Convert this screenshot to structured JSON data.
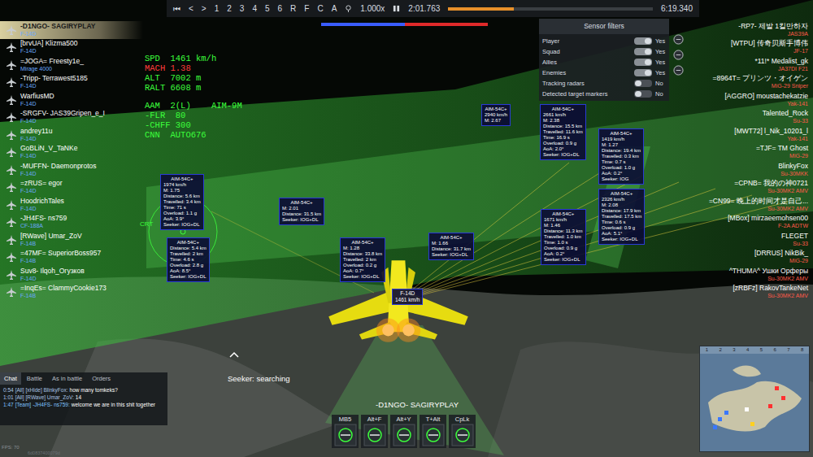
{
  "replay_bar": {
    "controls": [
      "⏮",
      "<",
      ">"
    ],
    "cameras": [
      "1",
      "2",
      "3",
      "4",
      "5",
      "6",
      "R",
      "F",
      "C",
      "A"
    ],
    "speed": "1.000x",
    "time": "2:01.763",
    "duration": "6:19.340",
    "level": 0.32
  },
  "score_bar": {
    "level": 0.5
  },
  "hud": {
    "flight": [
      {
        "text": "SPD  1461 km/h",
        "color": "#3cff3c"
      },
      {
        "text": "MACH 1.38",
        "color": "#ff3b3b"
      },
      {
        "text": "ALT  7002 m",
        "color": "#3cff3c"
      },
      {
        "text": "RALT 6608 m",
        "color": "#3cff3c"
      }
    ],
    "weapons": [
      {
        "text": "AAM  2(L)    AIM-9M",
        "color": "#3cff3c"
      },
      {
        "text": "-FLR  80",
        "color": "#3cff3c"
      },
      {
        "text": "-CHFF 300",
        "color": "#3cff3c"
      },
      {
        "text": "CNN  AUTO676",
        "color": "#3cff3c"
      }
    ],
    "reticle_label": "CRT",
    "seeker_status": "Seeker: searching"
  },
  "sensor_filters": {
    "title": "Sensor filters",
    "rows": [
      {
        "label": "Player",
        "on": true,
        "value": "Yes"
      },
      {
        "label": "Squad",
        "on": true,
        "value": "Yes"
      },
      {
        "label": "Allies",
        "on": true,
        "value": "Yes"
      },
      {
        "label": "Enemies",
        "on": true,
        "value": "Yes"
      },
      {
        "label": "Tracking radars",
        "on": false,
        "value": "No"
      },
      {
        "label": "Detected target markers",
        "on": false,
        "value": "No"
      }
    ]
  },
  "allies": [
    {
      "name": "-D1NGO- SAGIRYPLAY",
      "vehicle": "F-14D",
      "selected": true
    },
    {
      "name": "[brvUA] Klizma500",
      "vehicle": "F-14D",
      "selected": false
    },
    {
      "name": "=JOGA= Freesty1e_",
      "vehicle": "Mirage 4000",
      "selected": false
    },
    {
      "name": "-Tripp- Terrawest5185",
      "vehicle": "F-14D",
      "selected": false
    },
    {
      "name": "WarfiusMD",
      "vehicle": "F-14D",
      "selected": false
    },
    {
      "name": "-SRGFV- JAS39Gripen_e_I",
      "vehicle": "F-14D",
      "selected": false
    },
    {
      "name": "andrey11u",
      "vehicle": "F-14D",
      "selected": false
    },
    {
      "name": "GoBLiN_V_TaNKe",
      "vehicle": "F-14D",
      "selected": false
    },
    {
      "name": "-MUFFN- Daemonprotos",
      "vehicle": "F-14D",
      "selected": false
    },
    {
      "name": "=zRUS= egor",
      "vehicle": "F-14D",
      "selected": false
    },
    {
      "name": "HoodrichTales",
      "vehicle": "F-14D",
      "selected": false
    },
    {
      "name": "-JH4FS- ns759",
      "vehicle": "CF-188A",
      "selected": false
    },
    {
      "name": "[RWave] Umar_ZoV",
      "vehicle": "F-14B",
      "selected": false
    },
    {
      "name": "=47MF= SuperiorBoss957",
      "vehicle": "F-14B",
      "selected": false
    },
    {
      "name": "Suv8- Ilqoh_Огузков",
      "vehicle": "F-14D",
      "selected": false
    },
    {
      "name": "=InqEs= ClammyCookie173",
      "vehicle": "F-14B",
      "selected": false
    }
  ],
  "enemies": [
    {
      "name": "-RP7- 제발 1킬만하자",
      "vehicle": "JAS39A"
    },
    {
      "name": "[WTPU] 传奇贝斯手博伟",
      "vehicle": "JF-17"
    },
    {
      "name": "*11!* Medalist_gk",
      "vehicle": "JA37DI F21"
    },
    {
      "name": "=8964T= プリンツ・オイゲン",
      "vehicle": "MiG-29 Sniper"
    },
    {
      "name": "[AGGRO] moustachekatzie",
      "vehicle": "Yak-141"
    },
    {
      "name": "Talented_Rock",
      "vehicle": "Su-33"
    },
    {
      "name": "[MWT72] l_Nik_10201_l",
      "vehicle": "Yak-141"
    },
    {
      "name": "=TJF= TM Ghost",
      "vehicle": "MiG-29"
    },
    {
      "name": "BlinkyFox",
      "vehicle": "Su-30MKK"
    },
    {
      "name": "=CPNB= 我的の神0721",
      "vehicle": "Su-30MK2 AMV"
    },
    {
      "name": "=CN99= 晚上的时间才是自己...",
      "vehicle": "Su-30MK2 AMV"
    },
    {
      "name": "[MBox] mirzaeemohsen00",
      "vehicle": "F-2A ADTW"
    },
    {
      "name": "FLEGET",
      "vehicle": "Su-33"
    },
    {
      "name": "[DRRUS] NikBik_",
      "vehicle": "MiG-29"
    },
    {
      "name": "^THUMA^ Ушки Орферы",
      "vehicle": "Su-30MK2 AMV"
    },
    {
      "name": "[zRBFz] RakovTankeNet",
      "vehicle": "Su-30MK2 AMV"
    }
  ],
  "missiles": [
    {
      "lines": [
        "AIM-54C+",
        "1974 km/h",
        "M: 1.75",
        "Distance: 5.6 km",
        "Travelled: 3.4 km",
        "Time: 71 s",
        "Overload: 1.1 g",
        "AoA: 3.9°",
        "Seeker: IOG+DL"
      ]
    },
    {
      "lines": [
        "AIM-54C+",
        "Distance: 5.4 km",
        "Travelled: 2 km",
        "Time: 4.6 s",
        "Overload: 2.8 g",
        "AoA: 8.5°",
        "Seeker: IOG+DL"
      ]
    },
    {
      "lines": [
        "AIM-54C+",
        "M: 2.01",
        "Distance: 31.5 km",
        "Seeker: IOG+DL"
      ]
    },
    {
      "lines": [
        "AIM-54C+",
        "M: 1.28",
        "Distance: 33.8 km",
        "Travelled: 2 km",
        "Overload: 0.2 g",
        "AoA: 0.7°",
        "Seeker: IOG+DL"
      ]
    },
    {
      "lines": [
        "AIM-54C+",
        "M: 1.66",
        "Distance: 31.7 km",
        "Seeker: IOG+DL"
      ]
    },
    {
      "lines": [
        "AIM-54C+",
        "2940 km/h",
        "M: 2.67"
      ]
    },
    {
      "lines": [
        "AIM-54C+",
        "2661 km/h",
        "M: 2.38",
        "Distance: 15.5 km",
        "Travelled: 11.6 km",
        "Time: 16.9 s",
        "Overload: 0.9 g",
        "AoA: 2.0°",
        "Seeker: IOG+DL"
      ]
    },
    {
      "lines": [
        "AIM-54C+",
        "1671 km/h",
        "M: 1.46",
        "Distance: 11.3 km",
        "Travelled: 1.0 km",
        "Time: 1.0 s",
        "Overload: 0.9 g",
        "AoA: 0.2°",
        "Seeker: IOG+DL"
      ]
    },
    {
      "lines": [
        "AIM-54C+",
        "1419 km/h",
        "M: 1.27",
        "Distance: 19.4 km",
        "Travelled: 0.3 km",
        "Time: 0.7 s",
        "Overload: 1.0 g",
        "AoA: 0.2°",
        "Seeker: IOG"
      ]
    },
    {
      "lines": [
        "AIM-54C+",
        "2326 km/h",
        "M: 2.08",
        "Distance: 17.9 km",
        "Travelled: 17.5 km",
        "Time: 0.6 s",
        "Overload: 0.9 g",
        "AoA: 5.1°",
        "Seeker: IOG+DL"
      ]
    }
  ],
  "player_tag": {
    "vehicle": "F-14D",
    "speed": "1461 km/h"
  },
  "player_name": "-D1NGO- SAGIRYPLAY",
  "chat": {
    "tabs": [
      {
        "label": "Chat",
        "selected": true
      },
      {
        "label": "Battle",
        "selected": false
      },
      {
        "label": "As in battle",
        "selected": false
      },
      {
        "label": "Orders",
        "selected": false
      }
    ],
    "messages": [
      {
        "time": "0:54",
        "channel": "[All]",
        "author": "[xHide] BlinkyFox:",
        "text": "how many tomkeks?",
        "color": "#a9c4e4"
      },
      {
        "time": "1:01",
        "channel": "[All]",
        "author": "[RWave] Umar_ZoV:",
        "text": "14",
        "color": "#a9c4e4"
      },
      {
        "time": "1:47",
        "channel": "[Team]",
        "author": "-JH4FS- ns759:",
        "text": "welcome we are in this shit together",
        "color": "#7fc4ff"
      }
    ]
  },
  "toolbar": [
    {
      "key": "MB5"
    },
    {
      "key": "Alt+F"
    },
    {
      "key": "Alt+Y"
    },
    {
      "key": "T+Alt"
    },
    {
      "key": "CpLk"
    }
  ],
  "minimap": {
    "columns": [
      "1",
      "2",
      "3",
      "4",
      "5",
      "6",
      "7",
      "8"
    ],
    "markers": [
      {
        "color": "#3a78ff"
      },
      {
        "color": "#3a78ff"
      },
      {
        "color": "#3a78ff"
      },
      {
        "color": "#ff3030"
      },
      {
        "color": "#ff3030"
      },
      {
        "color": "#ff3030"
      },
      {
        "color": "#ffffff"
      },
      {
        "color": "#ffd020"
      }
    ]
  },
  "fps": "FPS: 70",
  "build": "6d0837400079d"
}
